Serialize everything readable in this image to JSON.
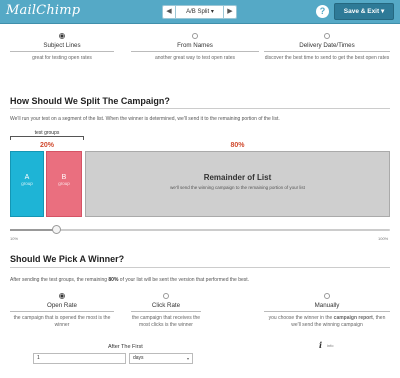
{
  "header": {
    "logo": "MailChimp",
    "split_label": "A/B Split ▾",
    "prev_arrow": "◀",
    "next_arrow": "▶",
    "help": "?",
    "save_label": "Save & Exit ▾"
  },
  "split_types": [
    {
      "title": "Subject Lines",
      "desc": "great for testing open rates",
      "selected": true
    },
    {
      "title": "From Names",
      "desc": "another great way to test open rates",
      "selected": false
    },
    {
      "title": "Delivery Date/Times",
      "desc": "discover the best time to send to get the best open rates",
      "selected": false
    }
  ],
  "split_section": {
    "title": "How Should We Split The Campaign?",
    "intro": "We'll run your test on a segment of the list. When the winner is determined, we'll send it to the remaining portion of the list.",
    "test_groups_label": "test groups",
    "test_pct": "20%",
    "remainder_pct": "80%",
    "group_a_letter": "A",
    "group_b_letter": "B",
    "group_sub": "group",
    "remainder_title": "Remainder of List",
    "remainder_desc": "we'll send the winning campaign to the remaining portion of your list",
    "slider_min": "10%",
    "slider_max": "100%",
    "slider_value": 0.12
  },
  "winner_section": {
    "title": "Should We Pick A Winner?",
    "intro_before": "After sending the test groups, the remaining ",
    "intro_bold": "80%",
    "intro_after": " of your list will be sent the version that performed the best.",
    "options": [
      {
        "title": "Open Rate",
        "desc": "the campaign that is opened the most is the winner",
        "selected": true
      },
      {
        "title": "Click Rate",
        "desc": "the campaign that receives the most clicks is the winner",
        "selected": false
      },
      {
        "title": "Manually",
        "desc_before": "you choose the winner in the ",
        "desc_bold": "campaign report",
        "desc_after": ", then we'll send the winning campaign",
        "selected": false
      }
    ],
    "info_icon": "i",
    "info_label": "info",
    "after_label": "After The First",
    "after_value": "1",
    "after_unit": "days",
    "unit_caret": "▾"
  },
  "colors": {
    "header_bg": "#55a9c6",
    "group_a": "#1eb4d6",
    "group_b": "#ea6f7f",
    "remainder": "#cfcfcf",
    "percent": "#d04a2e"
  }
}
